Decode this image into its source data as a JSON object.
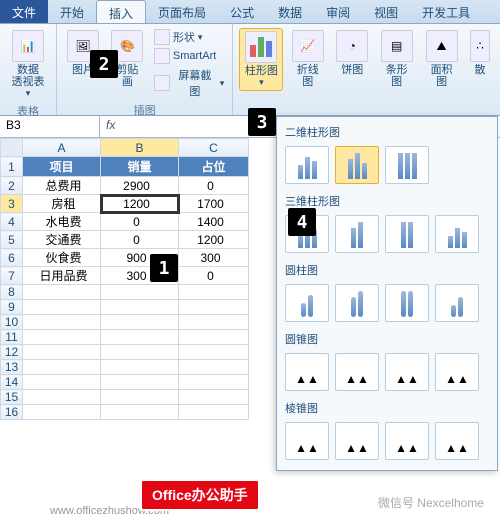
{
  "tabs": {
    "file": "文件",
    "home": "开始",
    "insert": "插入",
    "layout": "页面布局",
    "formulas": "公式",
    "data": "数据",
    "review": "审阅",
    "view": "视图",
    "dev": "开发工具"
  },
  "ribbon": {
    "pivot": "数据\n透视表",
    "table_group": "表格",
    "picture": "图片",
    "clipart": "剪贴画",
    "shapes": "形状",
    "smartart": "SmartArt",
    "screenshot": "屏幕截图",
    "illus_group": "插图",
    "column_chart": "柱形图",
    "line_chart": "折线图",
    "pie_chart": "饼图",
    "bar_chart": "条形图",
    "area_chart": "面积图",
    "scatter_chart": "散"
  },
  "namebox": "B3",
  "formula": "1200",
  "columns": [
    "A",
    "B",
    "C"
  ],
  "header_row": {
    "a": "项目",
    "b": "销量",
    "c": "占位"
  },
  "rows": [
    {
      "n": "1"
    },
    {
      "n": "2",
      "a": "总费用",
      "b": "2900",
      "c": "0"
    },
    {
      "n": "3",
      "a": "房租",
      "b": "1200",
      "c": "1700"
    },
    {
      "n": "4",
      "a": "水电费",
      "b": "0",
      "c": "1400"
    },
    {
      "n": "5",
      "a": "交通费",
      "b": "0",
      "c": "1200"
    },
    {
      "n": "6",
      "a": "伙食费",
      "b": "900",
      "c": "300"
    },
    {
      "n": "7",
      "a": "日用品费",
      "b": "300",
      "c": "0"
    },
    {
      "n": "8"
    },
    {
      "n": "9"
    },
    {
      "n": "10"
    },
    {
      "n": "11"
    },
    {
      "n": "12"
    },
    {
      "n": "13"
    },
    {
      "n": "14"
    },
    {
      "n": "15"
    },
    {
      "n": "16"
    }
  ],
  "chart_panel": {
    "sec1": "二维柱形图",
    "sec2": "三维柱形图",
    "sec3": "圆柱图",
    "sec4": "圆锥图",
    "sec5": "棱锥图"
  },
  "badge": "Office办公助手",
  "url": "www.officezhushow.com",
  "wm": "微信号  Nexcelhome"
}
